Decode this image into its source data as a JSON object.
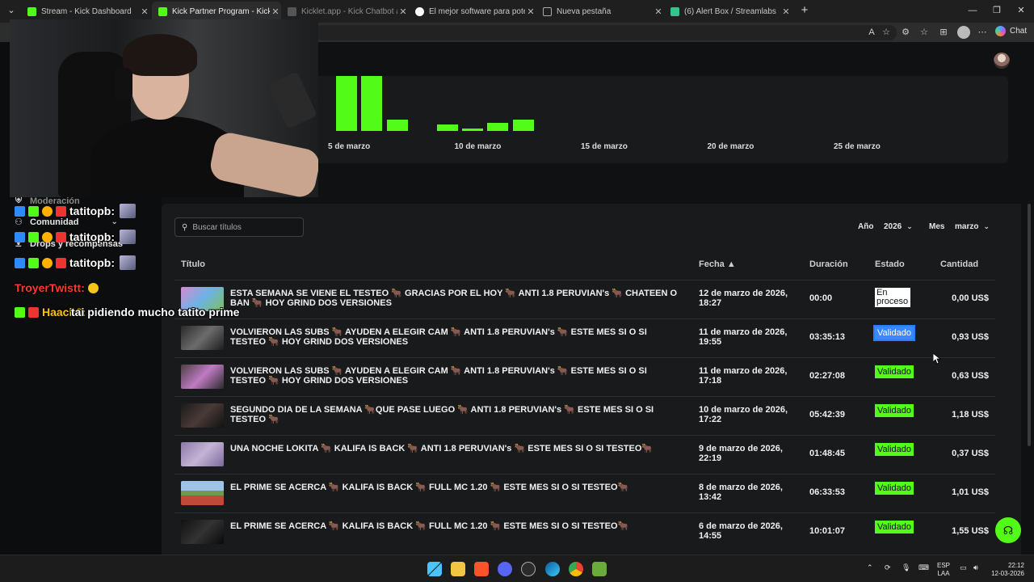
{
  "browser": {
    "tabs": [
      {
        "label": "Stream - Kick Dashboard",
        "color": "#53fc18"
      },
      {
        "label": "Kick Partner Program - Kick Dashb",
        "color": "#53fc18"
      },
      {
        "label": "Kicklet.app - Kick Chatbot and Ov",
        "color": "#6a6a6a"
      },
      {
        "label": "El mejor software para potenciar tu",
        "color": "#ffffff"
      },
      {
        "label": "Nueva pestaña",
        "color": "#8a8a8a"
      },
      {
        "label": "(6) Alert Box / Streamlabs",
        "color": "#31c48d"
      }
    ],
    "chat_button_label": "Chat"
  },
  "sidebar": {
    "items": [
      {
        "label": "Moderación",
        "icon": "shield-icon"
      },
      {
        "label": "Comunidad",
        "icon": "people-icon"
      },
      {
        "label": "Drops y recompensas",
        "icon": "gift-icon"
      }
    ]
  },
  "chart_data": {
    "type": "bar",
    "x_tick_labels": [
      "5 de marzo",
      "10 de marzo",
      "15 de marzo",
      "20 de marzo",
      "25 de marzo"
    ],
    "visible_bars": [
      {
        "day": 2,
        "value": 1.0
      },
      {
        "day": 3,
        "value": 1.0
      },
      {
        "day": 4,
        "value": 0.2
      },
      {
        "day": 6,
        "value": 0.12
      },
      {
        "day": 7,
        "value": 0.05
      },
      {
        "day": 8,
        "value": 0.15
      },
      {
        "day": 9,
        "value": 0.2
      }
    ],
    "bar_color": "#53fc18"
  },
  "filters": {
    "search_placeholder": "Buscar títulos",
    "year_label": "Año",
    "year_value": "2026",
    "month_label": "Mes",
    "month_value": "marzo"
  },
  "table": {
    "headers": {
      "title": "Título",
      "date": "Fecha ▲",
      "duration": "Duración",
      "status": "Estado",
      "amount": "Cantidad"
    },
    "rows": [
      {
        "title": "ESTA SEMANA SE VIENE EL TESTEO 🐂 GRACIAS POR EL HOY 🐂 ANTI 1.8 PERUVIAN's 🐂 CHATEEN O BAN 🐂 HOY GRIND DOS VERSIONES",
        "date": "12 de marzo de 2026, 18:27",
        "duration": "00:00",
        "status": "En proceso",
        "amount": "0,00 US$"
      },
      {
        "title": "VOLVIERON LAS SUBS 🐂 AYUDEN A ELEGIR CAM 🐂 ANTI 1.8 PERUVIAN's 🐂 ESTE MES SI O SI TESTEO 🐂 HOY GRIND DOS VERSIONES",
        "date": "11 de marzo de 2026, 19:55",
        "duration": "03:35:13",
        "status": "Validado",
        "amount": "0,93 US$"
      },
      {
        "title": "VOLVIERON LAS SUBS 🐂 AYUDEN A ELEGIR CAM 🐂 ANTI 1.8 PERUVIAN's 🐂 ESTE MES SI O SI TESTEO 🐂 HOY GRIND DOS VERSIONES",
        "date": "11 de marzo de 2026, 17:18",
        "duration": "02:27:08",
        "status": "Validado",
        "amount": "0,63 US$"
      },
      {
        "title": "SEGUNDO DIA DE LA SEMANA 🐂QUE PASE LUEGO 🐂 ANTI 1.8 PERUVIAN's 🐂 ESTE MES SI O SI TESTEO 🐂",
        "date": "10 de marzo de 2026, 17:22",
        "duration": "05:42:39",
        "status": "Validado",
        "amount": "1,18 US$"
      },
      {
        "title": "UNA NOCHE LOKITA 🐂 KALIFA IS BACK 🐂 ANTI 1.8 PERUVIAN's 🐂 ESTE MES SI O SI TESTEO🐂",
        "date": "9 de marzo de 2026, 22:19",
        "duration": "01:48:45",
        "status": "Validado",
        "amount": "0,37 US$"
      },
      {
        "title": "EL PRIME SE ACERCA 🐂 KALIFA IS BACK 🐂 FULL MC 1.20 🐂 ESTE MES SI O SI TESTEO🐂",
        "date": "8 de marzo de 2026, 13:42",
        "duration": "06:33:53",
        "status": "Validado",
        "amount": "1,01 US$"
      },
      {
        "title": "EL PRIME SE ACERCA 🐂 KALIFA IS BACK 🐂 FULL MC 1.20 🐂 ESTE MES SI O SI TESTEO🐂",
        "date": "6 de marzo de 2026, 14:55",
        "duration": "10:01:07",
        "status": "Validado",
        "amount": "1,55 US$"
      }
    ]
  },
  "chat_overlay": {
    "lines": [
      {
        "name": "tatitopb:",
        "message": "",
        "name_color": "#ffffff"
      },
      {
        "name": "tatitopb:",
        "message": "",
        "name_color": "#ffffff"
      },
      {
        "name": "tatitopb:",
        "message": "",
        "name_color": "#ffffff"
      },
      {
        "name": "TroyerTwistt:",
        "message": "",
        "name_color": "#ff3b30"
      },
      {
        "name": "Haach3:",
        "message": "tai pidiendo mucho tatito prime",
        "name_color": "#ffc400"
      }
    ]
  },
  "taskbar": {
    "lang_top": "ESP",
    "lang_bottom": "LAA",
    "time": "22:12",
    "date": "12-03-2026"
  }
}
